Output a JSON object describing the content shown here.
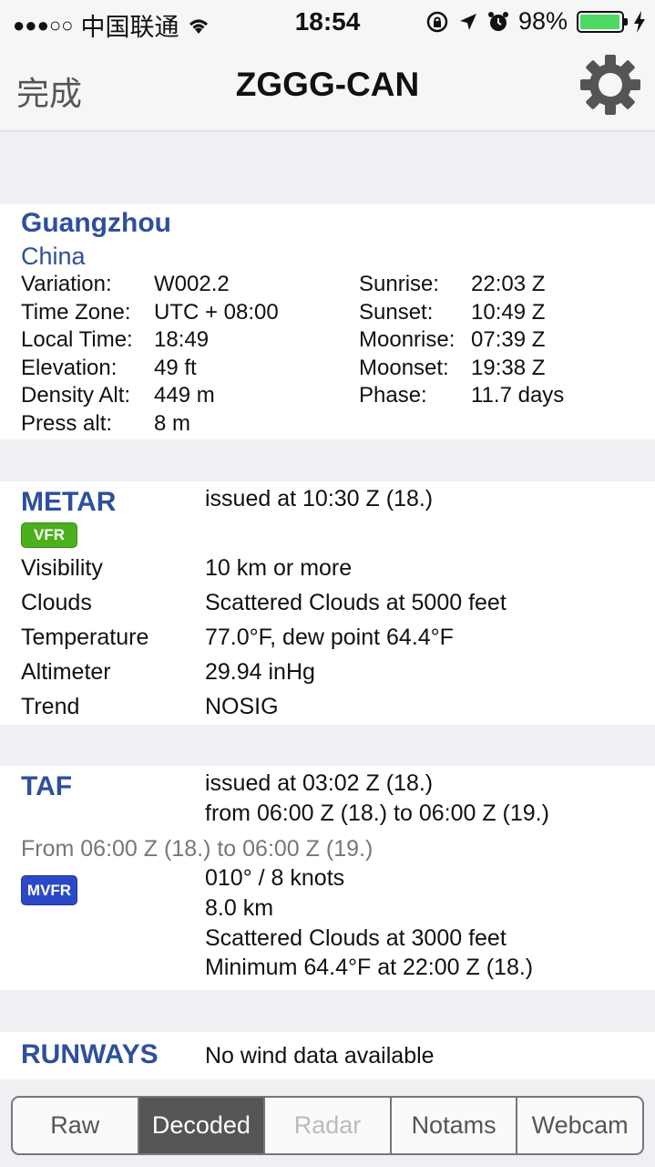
{
  "status": {
    "signal_dots": "●●●○○",
    "carrier": "中国联通",
    "time": "18:54",
    "battery": "98%",
    "battery_level": 0.98
  },
  "nav": {
    "done": "完成",
    "title": "ZGGG-CAN"
  },
  "location": {
    "city": "Guangzhou",
    "country": "China",
    "left": [
      {
        "k": "Variation:",
        "v": "W002.2"
      },
      {
        "k": "Time Zone:",
        "v": "UTC + 08:00"
      },
      {
        "k": "Local Time:",
        "v": "18:49"
      },
      {
        "k": "Elevation:",
        "v": "49 ft"
      },
      {
        "k": "Density Alt:",
        "v": "449 m"
      },
      {
        "k": "Press alt:",
        "v": "8 m"
      }
    ],
    "right": [
      {
        "k": "Sunrise:",
        "v": "22:03 Z"
      },
      {
        "k": "Sunset:",
        "v": "10:49 Z"
      },
      {
        "k": "Moonrise:",
        "v": "07:39 Z"
      },
      {
        "k": "Moonset:",
        "v": "19:38 Z"
      },
      {
        "k": "Phase:",
        "v": "11.7 days"
      }
    ]
  },
  "metar": {
    "heading": "METAR",
    "issued": "issued at 10:30 Z (18.)",
    "badge": "VFR",
    "rows": [
      {
        "k": "Visibility",
        "v": "10 km or more"
      },
      {
        "k": "Clouds",
        "v": "Scattered Clouds at 5000 feet"
      },
      {
        "k": "Temperature",
        "v": "77.0°F, dew point 64.4°F"
      },
      {
        "k": "Altimeter",
        "v": "29.94 inHg"
      },
      {
        "k": "Trend",
        "v": "NOSIG"
      }
    ]
  },
  "taf": {
    "heading": "TAF",
    "issued": "issued at 03:02 Z (18.)",
    "validity": "from 06:00 Z (18.) to 06:00 Z (19.)",
    "period": "From 06:00 Z (18.) to 06:00 Z (19.)",
    "badge": "MVFR",
    "lines": [
      "010° / 8 knots",
      "8.0 km",
      "Scattered Clouds at 3000 feet",
      "Minimum 64.4°F at 22:00 Z (18.)"
    ]
  },
  "runways": {
    "heading": "RUNWAYS",
    "text": "No wind data available"
  },
  "tabs": {
    "raw": "Raw",
    "decoded": "Decoded",
    "radar": "Radar",
    "notams": "Notams",
    "webcam": "Webcam",
    "selected": "Decoded"
  },
  "colors": {
    "heading_blue": "#2e4f9d",
    "vfr_green": "#4caf1c",
    "mvfr_blue": "#2b49c7",
    "battery_green": "#4cd964"
  }
}
